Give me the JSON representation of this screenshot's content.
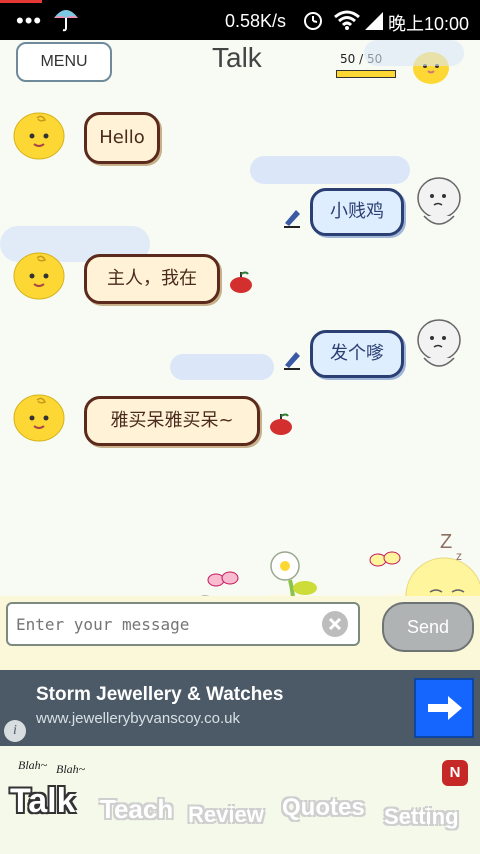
{
  "status_bar": {
    "dots": "•••",
    "network_speed": "0.58K/s",
    "time": "晚上10:00"
  },
  "header": {
    "menu_label": "MENU",
    "title": "Talk",
    "counter": "50 / 50",
    "counter_progress": 1.0
  },
  "messages": [
    {
      "side": "left",
      "text": "Hello"
    },
    {
      "side": "right",
      "text": "小贱鸡"
    },
    {
      "side": "left",
      "text": "主人，我在"
    },
    {
      "side": "right",
      "text": "发个嗲"
    },
    {
      "side": "left",
      "text": "雅买呆雅买呆~"
    }
  ],
  "input": {
    "placeholder": "Enter your message",
    "send_label": "Send"
  },
  "ad": {
    "title": "Storm Jewellery & Watches",
    "url": "www.jewellerybyvanscoy.co.uk",
    "info_label": "i"
  },
  "nav": {
    "blah1": "Blah~",
    "blah2": "Blah~",
    "items": [
      "Talk",
      "Teach",
      "Review",
      "Quotes",
      "Setting"
    ],
    "badge": "N"
  },
  "colors": {
    "status_bar_bg": "#000000",
    "chat_bg": "#f7fbf3",
    "send_button_bg": "#b0b3b3",
    "ad_bg": "#4b5a66",
    "ad_go_bg": "#1565ff",
    "badge_bg": "#c62828"
  }
}
